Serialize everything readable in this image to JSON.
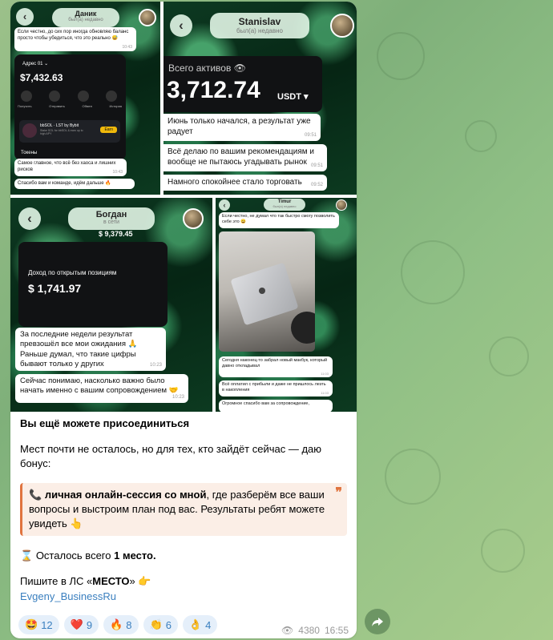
{
  "post": {
    "collage": {
      "s1": {
        "name": "Даник",
        "status": "был(а) недавно",
        "msg1": "Если честно, до сих пор иногда обновляю баланс просто чтобы убедиться, что это реально 😅",
        "msg1_time": "10:43",
        "wallet_address": "Адрес 01 ⌄",
        "wallet_balance": "$7,432.63",
        "wallet_actions": [
          "Получить",
          "Отправить",
          "Обмен",
          "История"
        ],
        "promo_title": "bbSOL · LST by Bybit",
        "promo_sub": "Stake SOL for bbSOL & earn up to high APY",
        "promo_btn": "Earn",
        "tokens": "Токены",
        "msg2": "Самое главное, что всё без хаоса и лишних рисков",
        "msg2_time": "10:43",
        "msg3": "Спасибо вам и команде, идём дальше 🔥"
      },
      "s2": {
        "name": "Stanislav",
        "status": "был(а) недавно",
        "total_label": "Всего активов",
        "total_value": "3,712.74",
        "total_cur": "USDT ▾",
        "msg1": "Июнь только начался, а результат уже радует",
        "msg1_time": "09:51",
        "msg2": "Всё делаю по вашим рекомендациям и вообще не пытаюсь угадывать рынок",
        "msg2_time": "09:51",
        "msg3": "Намного спокойнее стало торговать",
        "msg3_time": "09:52"
      },
      "s3": {
        "name": "Богдан",
        "status": "в сети",
        "top_value": "$ 9,379.45",
        "pnl_label": "Доход по открытым позициям",
        "pnl_value": "$ 1,741.97",
        "msg1": "За последние недели результат превзошёл все мои ожидания 🙏 Раньше думал, что такие цифры бывают только у других",
        "msg1_time": "10:23",
        "msg2": "Сейчас понимаю, насколько важно было начать именно с вашим сопровождением 🤝",
        "msg2_time": "10:23"
      },
      "s4": {
        "name": "Timur",
        "status": "был(а) недавно",
        "msg1": "Если честно, не думал что так быстро смогу позволить себе это 😄",
        "msg2": "Сегодня наконец-то забрал новый макбук, который давно откладывал",
        "msg2_time": "11:03",
        "msg3": "Всё оплатил с прибыли и даже не пришлось лезть в накопления",
        "msg3_time": "11:03",
        "msg4": "Огромное спасибо вам за сопровождение,"
      }
    },
    "caption": {
      "title": "Вы ещё можете присоединиться",
      "p1": "Мест почти не осталось, но для тех, кто зайдёт сейчас — даю бонус:",
      "quote_icon": "📞",
      "quote_bold": "личная онлайн-сессия со мной",
      "quote_rest": ", где разберём все ваши вопросы и выстроим план под вас. Результаты ребят можете увидеть 👆",
      "quote_mark": "❞",
      "spots_icon": "⌛",
      "spots_pre": "Осталось всего ",
      "spots_bold": "1 место.",
      "cta_pre": "Пишите в ЛС «",
      "cta_bold": "МЕСТО",
      "cta_post": "» 👉",
      "handle": "Evgeny_BusinessRu"
    },
    "reactions": [
      {
        "emoji": "🤩",
        "count": "12"
      },
      {
        "emoji": "❤️",
        "count": "9"
      },
      {
        "emoji": "🔥",
        "count": "8"
      },
      {
        "emoji": "👏",
        "count": "6"
      },
      {
        "emoji": "👌",
        "count": "4"
      }
    ],
    "views": "4380",
    "time": "16:55"
  },
  "colors": {
    "accent": "#3a7fbf",
    "quote_border": "#e0743f",
    "background": "#8fbf85"
  }
}
